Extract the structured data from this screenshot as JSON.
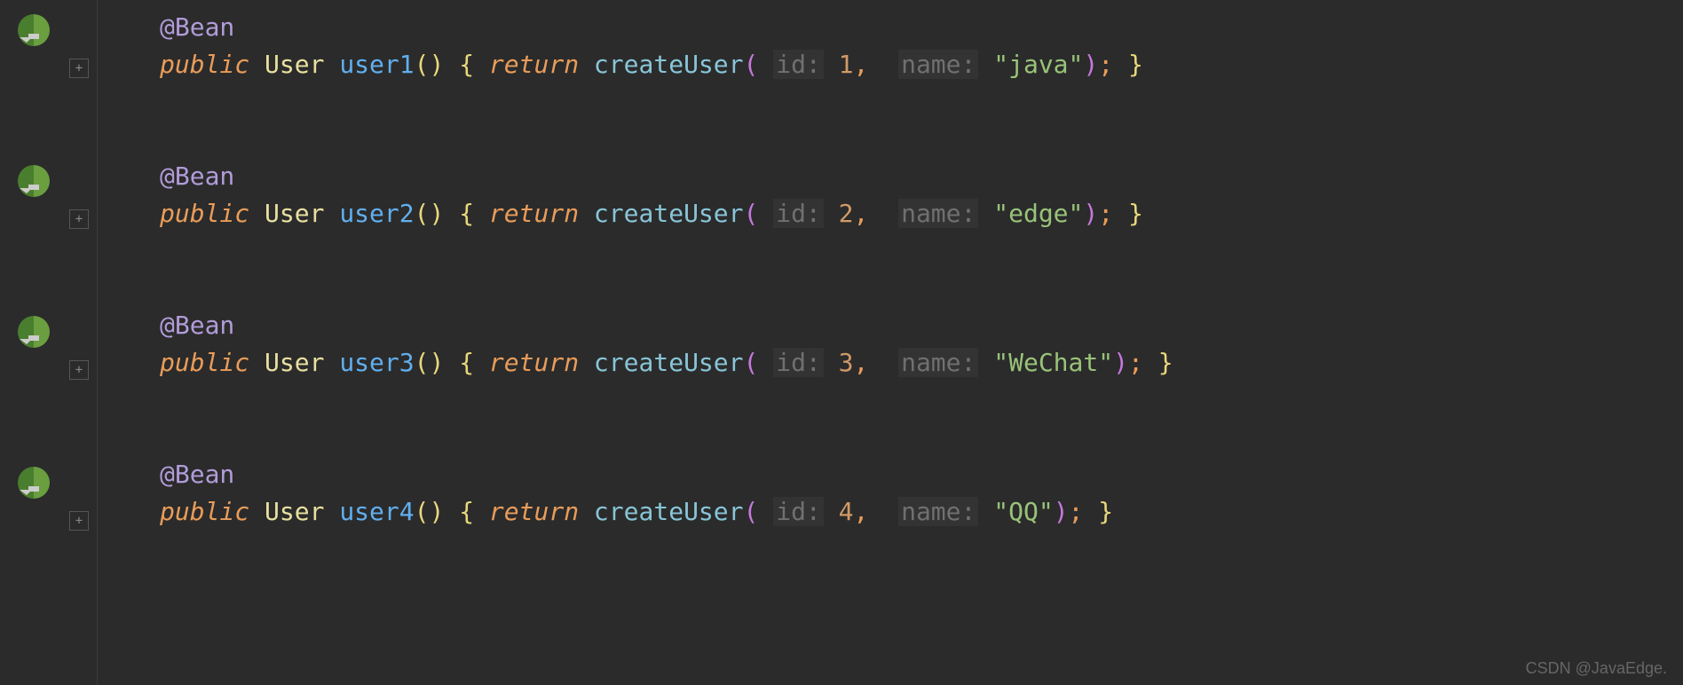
{
  "icons": {
    "bean": "bean-icon"
  },
  "beans": [
    {
      "annotation": "@Bean",
      "public": "public",
      "type": "User",
      "method": "user1",
      "return_kw": "return",
      "call": "createUser",
      "id_hint": "id:",
      "id_val": "1",
      "name_hint": "name:",
      "name_val": "\"java\""
    },
    {
      "annotation": "@Bean",
      "public": "public",
      "type": "User",
      "method": "user2",
      "return_kw": "return",
      "call": "createUser",
      "id_hint": "id:",
      "id_val": "2",
      "name_hint": "name:",
      "name_val": "\"edge\""
    },
    {
      "annotation": "@Bean",
      "public": "public",
      "type": "User",
      "method": "user3",
      "return_kw": "return",
      "call": "createUser",
      "id_hint": "id:",
      "id_val": "3",
      "name_hint": "name:",
      "name_val": "\"WeChat\""
    },
    {
      "annotation": "@Bean",
      "public": "public",
      "type": "User",
      "method": "user4",
      "return_kw": "return",
      "call": "createUser",
      "id_hint": "id:",
      "id_val": "4",
      "name_hint": "name:",
      "name_val": "\"QQ\""
    }
  ],
  "fold_marker": "+",
  "watermark": "CSDN @JavaEdge."
}
